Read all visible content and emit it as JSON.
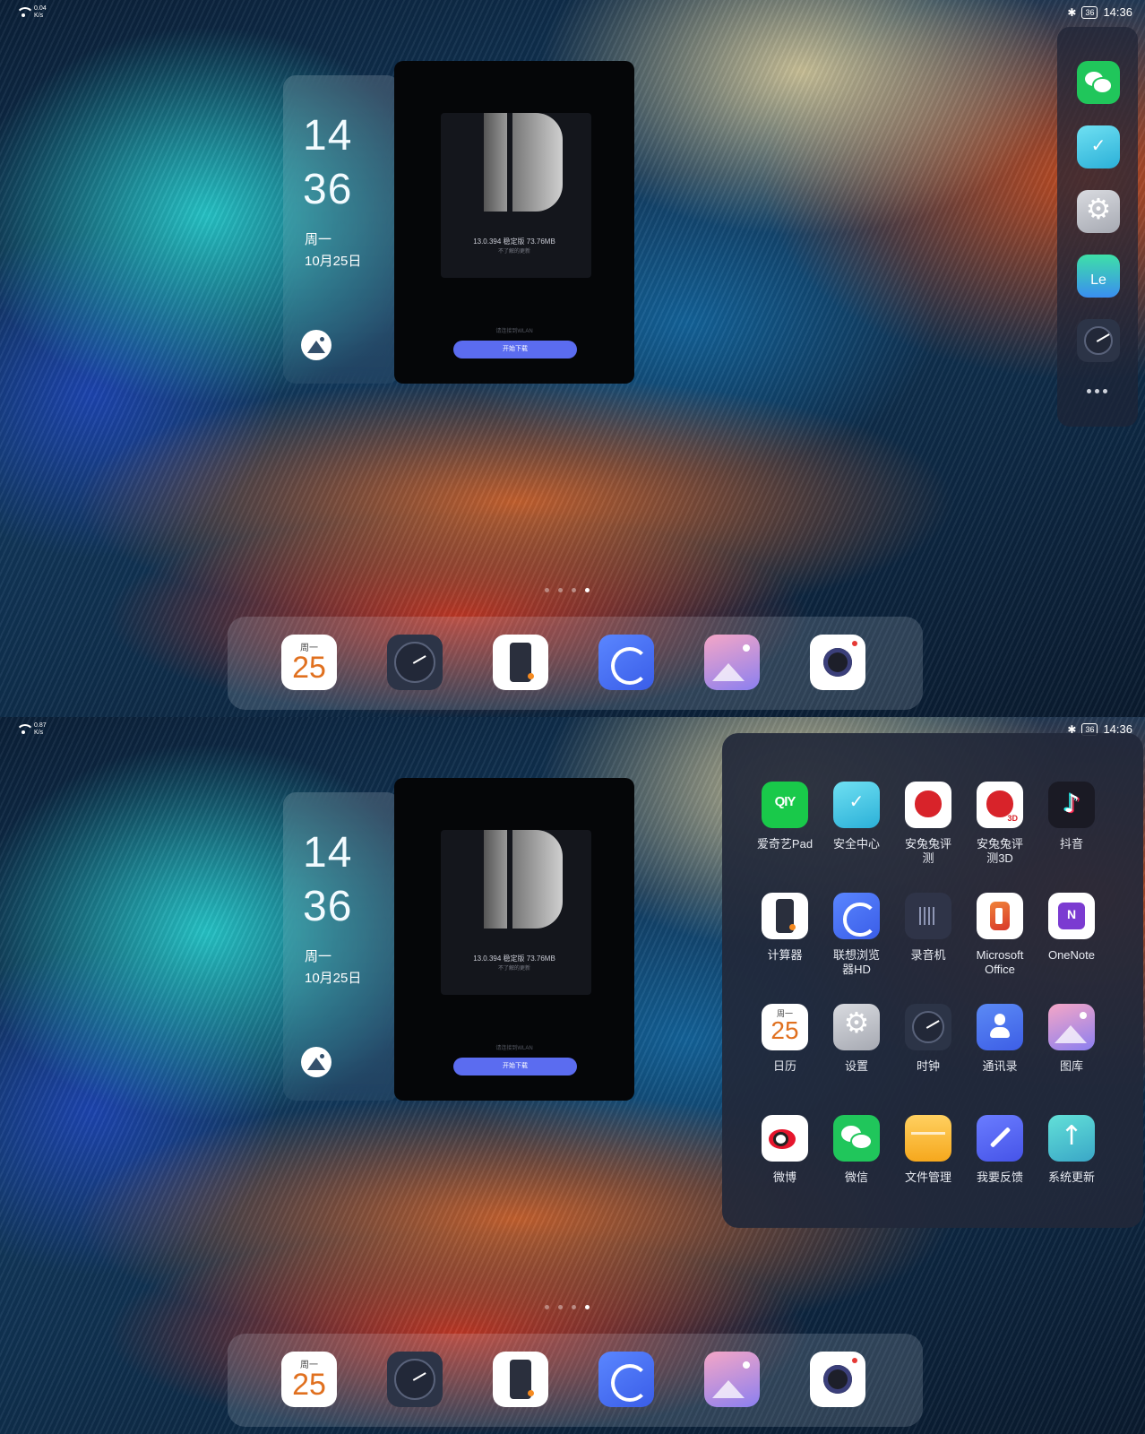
{
  "top": {
    "status": {
      "net_speed": "0.04\nK/s",
      "battery": "36",
      "time": "14:36"
    },
    "clock_widget": {
      "hour": "14",
      "minute": "36",
      "weekday": "周一",
      "date": "10月25日"
    },
    "update_card": {
      "version": "13.0.394 稳定版 73.76MB",
      "subtitle": "不了解的更新",
      "note": "请连接到WLAN",
      "button": "开始下载"
    },
    "side_dock": {
      "apps": [
        "wechat-icon",
        "security-icon",
        "settings-icon",
        "le-icon",
        "clock-icon"
      ],
      "le_text": "Le"
    },
    "dock": {
      "calendar_weekday": "周一",
      "calendar_day": "25"
    }
  },
  "bottom": {
    "status": {
      "net_speed": "0.87\nK/s",
      "battery": "36",
      "time": "14:36"
    },
    "clock_widget": {
      "hour": "14",
      "minute": "36",
      "weekday": "周一",
      "date": "10月25日"
    },
    "update_card": {
      "version": "13.0.394 稳定版 73.76MB",
      "subtitle": "不了解的更新",
      "note": "请连接到WLAN",
      "button": "开始下载"
    },
    "dock": {
      "calendar_weekday": "周一",
      "calendar_day": "25"
    },
    "drawer": {
      "apps": [
        {
          "label": "爱奇艺Pad",
          "icon": "iqiyi-icon",
          "glyph": "QIY"
        },
        {
          "label": "安全中心",
          "icon": "security-icon"
        },
        {
          "label": "安兔兔评\n测",
          "icon": "antutu-icon"
        },
        {
          "label": "安兔兔评\n测3D",
          "icon": "antutu-3d-icon",
          "glyph": "3D"
        },
        {
          "label": "抖音",
          "icon": "douyin-icon",
          "glyph": "♪"
        },
        {
          "label": "计算器",
          "icon": "calculator-icon"
        },
        {
          "label": "联想浏览\n器HD",
          "icon": "browser-icon"
        },
        {
          "label": "录音机",
          "icon": "recorder-icon"
        },
        {
          "label": "Microsoft\nOffice",
          "icon": "office-icon"
        },
        {
          "label": "OneNote",
          "icon": "onenote-icon",
          "glyph": "N"
        },
        {
          "label": "日历",
          "icon": "calendar-icon",
          "weekday": "周一",
          "day": "25"
        },
        {
          "label": "设置",
          "icon": "settings-icon"
        },
        {
          "label": "时钟",
          "icon": "clock-icon"
        },
        {
          "label": "通讯录",
          "icon": "contacts-icon"
        },
        {
          "label": "图库",
          "icon": "gallery-icon"
        },
        {
          "label": "微博",
          "icon": "weibo-icon"
        },
        {
          "label": "微信",
          "icon": "wechat-icon"
        },
        {
          "label": "文件管理",
          "icon": "files-icon"
        },
        {
          "label": "我要反馈",
          "icon": "feedback-icon"
        },
        {
          "label": "系统更新",
          "icon": "system-update-icon",
          "glyph": "↑"
        }
      ]
    }
  }
}
